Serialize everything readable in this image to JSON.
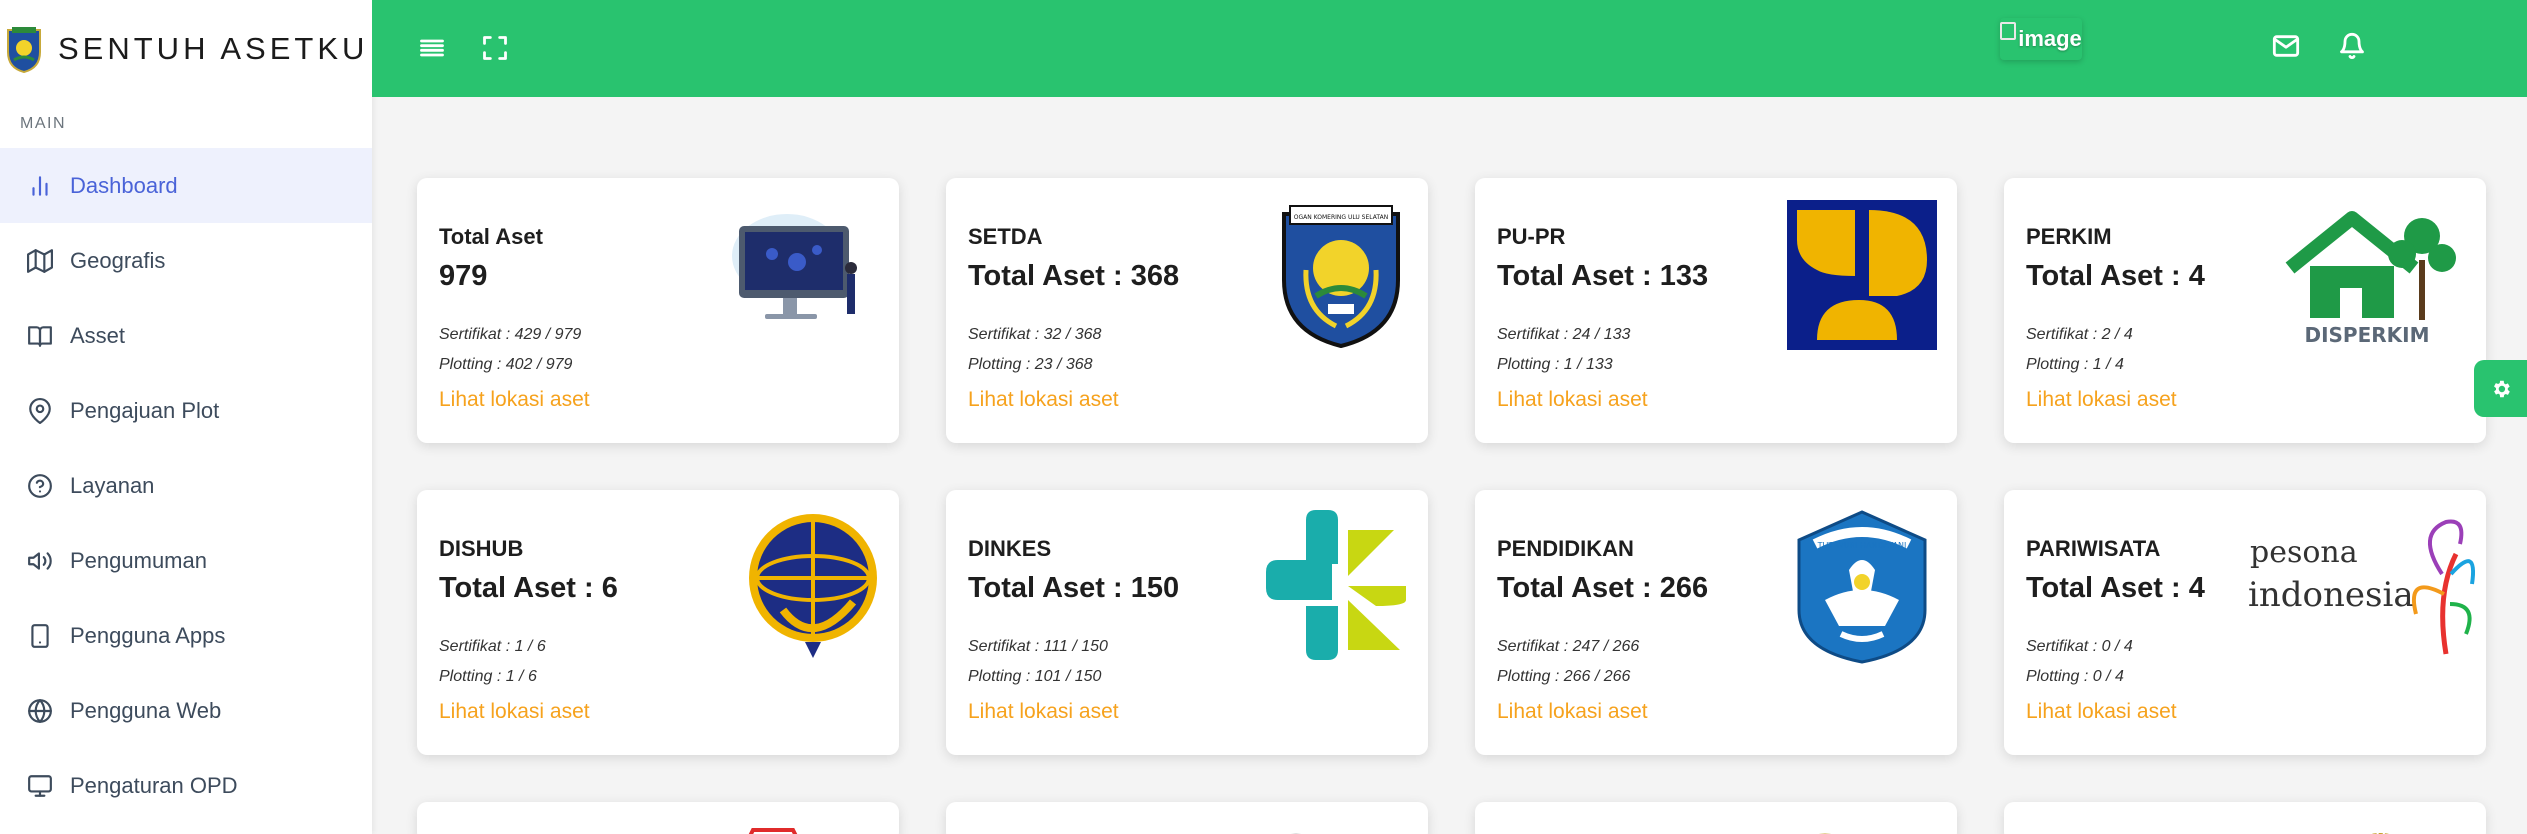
{
  "app": {
    "title": "SENTUH ASETKU"
  },
  "sidebar": {
    "section_label": "MAIN",
    "items": [
      {
        "label": "Dashboard",
        "icon": "bar-chart-icon",
        "active": true
      },
      {
        "label": "Geografis",
        "icon": "map-icon"
      },
      {
        "label": "Asset",
        "icon": "book-icon"
      },
      {
        "label": "Pengajuan Plot",
        "icon": "map-pin-icon"
      },
      {
        "label": "Layanan",
        "icon": "help-circle-icon"
      },
      {
        "label": "Pengumuman",
        "icon": "megaphone-icon"
      },
      {
        "label": "Pengguna Apps",
        "icon": "smartphone-icon"
      },
      {
        "label": "Pengguna Web",
        "icon": "globe-icon"
      },
      {
        "label": "Pengaturan OPD",
        "icon": "monitor-icon"
      }
    ]
  },
  "header": {
    "menu_icon": "menu-icon",
    "fullscreen_icon": "fullscreen-icon",
    "mail_icon": "mail-icon",
    "bell_icon": "bell-icon",
    "avatar_alt": "image"
  },
  "cards": [
    {
      "name": "Total Aset",
      "total": "979",
      "sertifikat": "Sertifikat : 429 / 979",
      "plotting": "Plotting : 402 / 979",
      "link": "Lihat lokasi aset",
      "logo": "computer-illustration"
    },
    {
      "name": "SETDA",
      "total": "Total Aset : 368",
      "sertifikat": "Sertifikat : 32 / 368",
      "plotting": "Plotting : 23 / 368",
      "link": "Lihat lokasi aset",
      "logo": "oku-selatan-emblem",
      "logo_text": "OGAN KOMERING ULU SELATAN"
    },
    {
      "name": "PU-PR",
      "total": "Total Aset : 133",
      "sertifikat": "Sertifikat : 24 / 133",
      "plotting": "Plotting : 1 / 133",
      "link": "Lihat lokasi aset",
      "logo": "pupr-logo"
    },
    {
      "name": "PERKIM",
      "total": "Total Aset : 4",
      "sertifikat": "Sertifikat : 2 / 4",
      "plotting": "Plotting : 1 / 4",
      "link": "Lihat lokasi aset",
      "logo": "disperkim-logo",
      "logo_text": "DISPERKIM"
    },
    {
      "name": "DISHUB",
      "total": "Total Aset : 6",
      "sertifikat": "Sertifikat : 1 / 6",
      "plotting": "Plotting : 1 / 6",
      "link": "Lihat lokasi aset",
      "logo": "dishub-logo"
    },
    {
      "name": "DINKES",
      "total": "Total Aset : 150",
      "sertifikat": "Sertifikat : 111 / 150",
      "plotting": "Plotting : 101 / 150",
      "link": "Lihat lokasi aset",
      "logo": "kemenkes-logo"
    },
    {
      "name": "PENDIDIKAN",
      "total": "Total Aset : 266",
      "sertifikat": "Sertifikat : 247 / 266",
      "plotting": "Plotting : 266 / 266",
      "link": "Lihat lokasi aset",
      "logo": "tut-wuri-handayani-logo",
      "logo_text": "TUT WURI HANDAYANI"
    },
    {
      "name": "PARIWISATA",
      "total": "Total Aset : 4",
      "sertifikat": "Sertifikat : 0 / 4",
      "plotting": "Plotting : 0 / 4",
      "link": "Lihat lokasi aset",
      "logo": "pesona-indonesia-logo",
      "logo_text_1": "pesona",
      "logo_text_2": "indonesia"
    }
  ],
  "colors": {
    "header": "#29c36f",
    "active": "#4a63d8",
    "link": "#f6a21d"
  }
}
